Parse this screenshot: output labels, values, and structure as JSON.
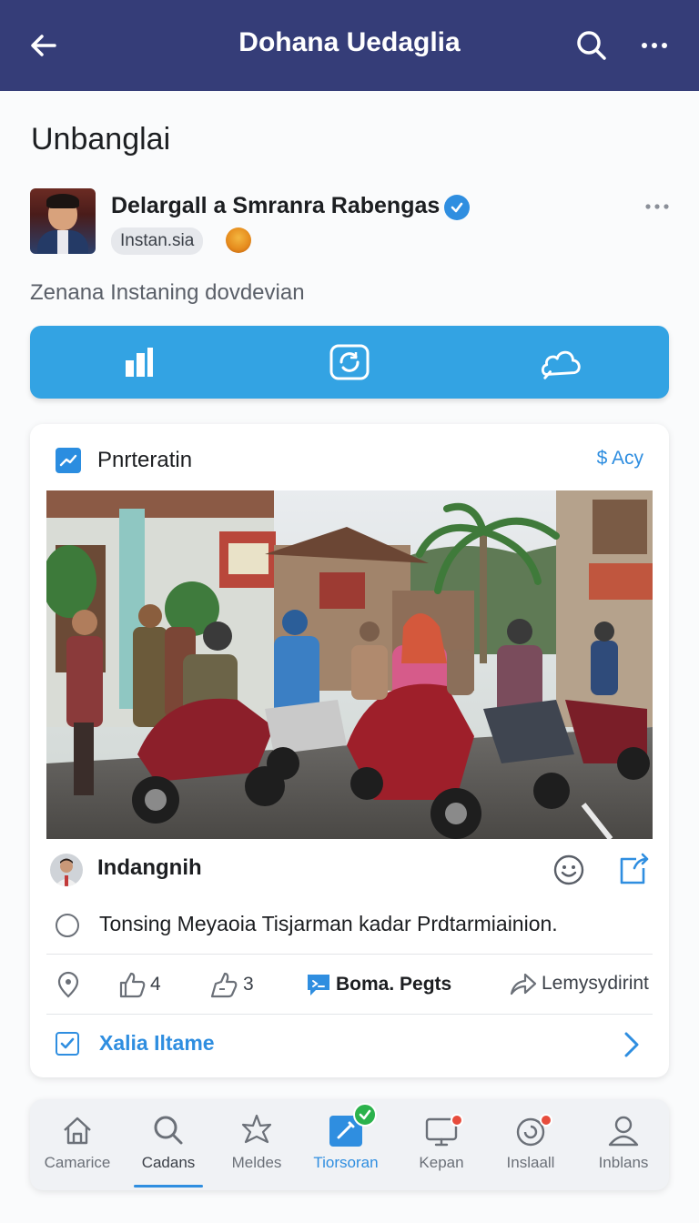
{
  "header": {
    "title": "Dohana Uedaglia",
    "back_icon": "arrow-left-icon",
    "search_icon": "search-icon",
    "more_icon": "more-horizontal-icon"
  },
  "section": {
    "title": "Unbanglai"
  },
  "profile": {
    "name": "Delargall a Smranra Rabengas",
    "verified": true,
    "handle": "Instan.sia",
    "subtitle": "Zenana Instaning dovdevian"
  },
  "action_bar": {
    "items": [
      {
        "icon": "bar-chart-icon"
      },
      {
        "icon": "camera-refresh-icon"
      },
      {
        "icon": "cloud-icon"
      }
    ],
    "color": "#33a3e3"
  },
  "card": {
    "title": "Pnrteratin",
    "link": "$ Acy",
    "poster_name": "Indangnih",
    "comment": "Tonsing Meyaoia Tisjarman kadar Prdtarmiainion.",
    "stats": {
      "likes": "4",
      "shares": "3",
      "comments_label": "Boma. Pegts",
      "forward_label": "Lemysydirint"
    },
    "footer_label": "Xalia Iltame"
  },
  "nav": {
    "items": [
      {
        "label": "Camarice",
        "icon": "home-icon"
      },
      {
        "label": "Cadans",
        "icon": "search-icon"
      },
      {
        "label": "Meldes",
        "icon": "star-icon"
      },
      {
        "label": "Tiorsoran",
        "icon": "edit-icon"
      },
      {
        "label": "Kepan",
        "icon": "monitor-icon"
      },
      {
        "label": "Inslaall",
        "icon": "refresh-icon"
      },
      {
        "label": "Inblans",
        "icon": "user-icon"
      }
    ]
  },
  "colors": {
    "header_bg": "#353d78",
    "accent": "#2f8ee0"
  }
}
